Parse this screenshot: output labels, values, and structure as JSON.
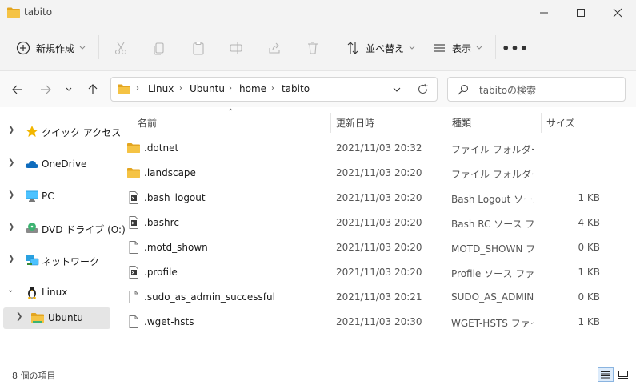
{
  "window": {
    "title": "tabito",
    "controls": [
      "minimize",
      "maximize",
      "close"
    ]
  },
  "toolbar": {
    "new_label": "新規作成",
    "sort_label": "並べ替え",
    "view_label": "表示",
    "more_label": "•••"
  },
  "address": {
    "breadcrumbs": [
      "Linux",
      "Ubuntu",
      "home",
      "tabito"
    ]
  },
  "search": {
    "placeholder": "tabitoの検索"
  },
  "sidebar": {
    "items": [
      {
        "label": "クイック アクセス",
        "icon": "star-icon"
      },
      {
        "label": "OneDrive",
        "icon": "cloud-icon"
      },
      {
        "label": "PC",
        "icon": "monitor-icon"
      },
      {
        "label": "DVD ドライブ (O:)",
        "icon": "dvd-drive-icon"
      },
      {
        "label": "ネットワーク",
        "icon": "network-icon"
      },
      {
        "label": "Linux",
        "icon": "linux-penguin-icon"
      },
      {
        "label": "Ubuntu",
        "icon": "folder-icon"
      }
    ]
  },
  "columns": {
    "name": "名前",
    "date": "更新日時",
    "type": "種類",
    "size": "サイズ"
  },
  "files": [
    {
      "name": ".dotnet",
      "date": "2021/11/03 20:32",
      "type": "ファイル フォルダー",
      "size": "",
      "icon": "folder-icon"
    },
    {
      "name": ".landscape",
      "date": "2021/11/03 20:20",
      "type": "ファイル フォルダー",
      "size": "",
      "icon": "folder-icon"
    },
    {
      "name": ".bash_logout",
      "date": "2021/11/03 20:20",
      "type": "Bash Logout ソース...",
      "size": "1 KB",
      "icon": "source-file-icon"
    },
    {
      "name": ".bashrc",
      "date": "2021/11/03 20:20",
      "type": "Bash RC ソース ファ...",
      "size": "4 KB",
      "icon": "source-file-icon"
    },
    {
      "name": ".motd_shown",
      "date": "2021/11/03 20:20",
      "type": "MOTD_SHOWN フ...",
      "size": "0 KB",
      "icon": "file-icon"
    },
    {
      "name": ".profile",
      "date": "2021/11/03 20:20",
      "type": "Profile ソース ファイル",
      "size": "1 KB",
      "icon": "source-file-icon"
    },
    {
      "name": ".sudo_as_admin_successful",
      "date": "2021/11/03 20:21",
      "type": "SUDO_AS_ADMIN...",
      "size": "0 KB",
      "icon": "file-icon"
    },
    {
      "name": ".wget-hsts",
      "date": "2021/11/03 20:30",
      "type": "WGET-HSTS ファイル",
      "size": "1 KB",
      "icon": "file-icon"
    }
  ],
  "status": {
    "item_count": "8 個の項目"
  },
  "colors": {
    "folder": "#f5c344",
    "folder_dark": "#e3a520",
    "accent": "#0067c0",
    "selected": "#e5e5e5"
  }
}
